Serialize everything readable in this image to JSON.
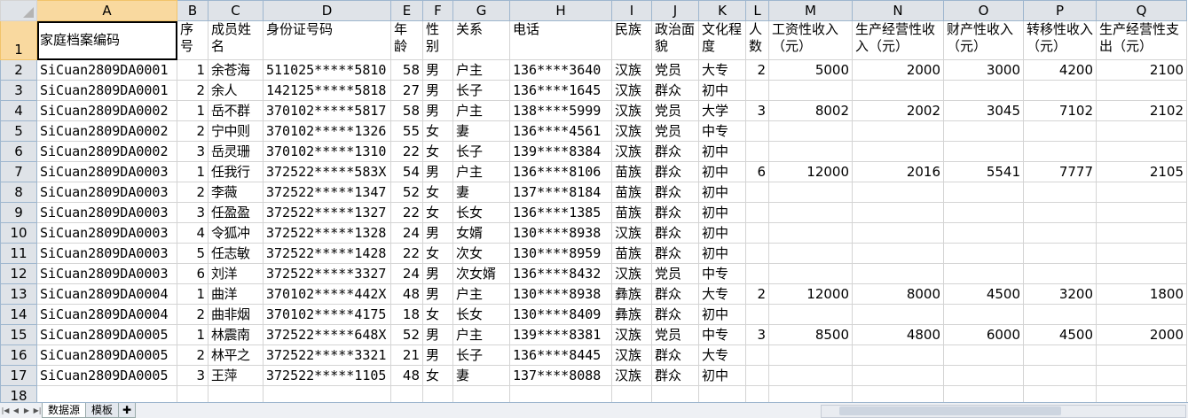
{
  "columns": [
    "A",
    "B",
    "C",
    "D",
    "E",
    "F",
    "G",
    "H",
    "I",
    "J",
    "K",
    "L",
    "M",
    "N",
    "O",
    "P",
    "Q"
  ],
  "header_row": {
    "num": "1",
    "cells": [
      "家庭档案编码",
      "序号",
      "成员姓名",
      "身份证号码",
      "年龄",
      "性别",
      "关系",
      "电话",
      "民族",
      "政治面貌",
      "文化程度",
      "人数",
      "工资性收入（元）",
      "生产经营性收入（元）",
      "财产性收入（元）",
      "转移性收入（元）",
      "生产经营性支出（元）"
    ]
  },
  "rows": [
    {
      "num": "2",
      "cells": [
        "SiCuan2809DA0001",
        "1",
        "余苍海",
        "511025*****5810",
        "58",
        "男",
        "户主",
        "136****3640",
        "汉族",
        "党员",
        "大专",
        "2",
        "5000",
        "2000",
        "3000",
        "4200",
        "2100"
      ]
    },
    {
      "num": "3",
      "cells": [
        "SiCuan2809DA0001",
        "2",
        "余人",
        "142125*****5818",
        "27",
        "男",
        "长子",
        "136****1645",
        "汉族",
        "群众",
        "初中",
        "",
        "",
        "",
        "",
        "",
        ""
      ]
    },
    {
      "num": "4",
      "cells": [
        "SiCuan2809DA0002",
        "1",
        "岳不群",
        "370102*****5817",
        "58",
        "男",
        "户主",
        "138****5999",
        "汉族",
        "党员",
        "大学",
        "3",
        "8002",
        "2002",
        "3045",
        "7102",
        "2102"
      ]
    },
    {
      "num": "5",
      "cells": [
        "SiCuan2809DA0002",
        "2",
        "宁中则",
        "370102*****1326",
        "55",
        "女",
        "妻",
        "136****4561",
        "汉族",
        "党员",
        "中专",
        "",
        "",
        "",
        "",
        "",
        ""
      ]
    },
    {
      "num": "6",
      "cells": [
        "SiCuan2809DA0002",
        "3",
        "岳灵珊",
        "370102*****1310",
        "22",
        "女",
        "长子",
        "139****8384",
        "汉族",
        "群众",
        "初中",
        "",
        "",
        "",
        "",
        "",
        ""
      ]
    },
    {
      "num": "7",
      "cells": [
        "SiCuan2809DA0003",
        "1",
        "任我行",
        "372522*****583X",
        "54",
        "男",
        "户主",
        "136****8106",
        "苗族",
        "群众",
        "初中",
        "6",
        "12000",
        "2016",
        "5541",
        "7777",
        "2105"
      ]
    },
    {
      "num": "8",
      "cells": [
        "SiCuan2809DA0003",
        "2",
        "李薇",
        "372522*****1347",
        "52",
        "女",
        "妻",
        "137****8184",
        "苗族",
        "群众",
        "初中",
        "",
        "",
        "",
        "",
        "",
        ""
      ]
    },
    {
      "num": "9",
      "cells": [
        "SiCuan2809DA0003",
        "3",
        "任盈盈",
        "372522*****1327",
        "22",
        "女",
        "长女",
        "136****1385",
        "苗族",
        "群众",
        "初中",
        "",
        "",
        "",
        "",
        "",
        ""
      ]
    },
    {
      "num": "10",
      "cells": [
        "SiCuan2809DA0003",
        "4",
        "令狐冲",
        "372522*****1328",
        "24",
        "男",
        "女婿",
        "130****8938",
        "汉族",
        "群众",
        "初中",
        "",
        "",
        "",
        "",
        "",
        ""
      ]
    },
    {
      "num": "11",
      "cells": [
        "SiCuan2809DA0003",
        "5",
        "任志敏",
        "372522*****1428",
        "22",
        "女",
        "次女",
        "130****8959",
        "苗族",
        "群众",
        "初中",
        "",
        "",
        "",
        "",
        "",
        ""
      ]
    },
    {
      "num": "12",
      "cells": [
        "SiCuan2809DA0003",
        "6",
        "刘洋",
        "372522*****3327",
        "24",
        "男",
        "次女婿",
        "136****8432",
        "汉族",
        "党员",
        "中专",
        "",
        "",
        "",
        "",
        "",
        ""
      ]
    },
    {
      "num": "13",
      "cells": [
        "SiCuan2809DA0004",
        "1",
        "曲洋",
        "370102*****442X",
        "48",
        "男",
        "户主",
        "130****8938",
        "彝族",
        "群众",
        "大专",
        "2",
        "12000",
        "8000",
        "4500",
        "3200",
        "1800"
      ]
    },
    {
      "num": "14",
      "cells": [
        "SiCuan2809DA0004",
        "2",
        "曲非烟",
        "370102*****4175",
        "18",
        "女",
        "长女",
        "130****8409",
        "彝族",
        "群众",
        "初中",
        "",
        "",
        "",
        "",
        "",
        ""
      ]
    },
    {
      "num": "15",
      "cells": [
        "SiCuan2809DA0005",
        "1",
        "林震南",
        "372522*****648X",
        "52",
        "男",
        "户主",
        "139****8381",
        "汉族",
        "党员",
        "中专",
        "3",
        "8500",
        "4800",
        "6000",
        "4500",
        "2000"
      ]
    },
    {
      "num": "16",
      "cells": [
        "SiCuan2809DA0005",
        "2",
        "林平之",
        "372522*****3321",
        "21",
        "男",
        "长子",
        "136****8445",
        "汉族",
        "群众",
        "大专",
        "",
        "",
        "",
        "",
        "",
        ""
      ]
    },
    {
      "num": "17",
      "cells": [
        "SiCuan2809DA0005",
        "3",
        "王萍",
        "372522*****1105",
        "48",
        "女",
        "妻",
        "137****8088",
        "汉族",
        "群众",
        "初中",
        "",
        "",
        "",
        "",
        "",
        ""
      ]
    },
    {
      "num": "18",
      "cells": [
        "",
        "",
        "",
        "",
        "",
        "",
        "",
        "",
        "",
        "",
        "",
        "",
        "",
        "",
        "",
        "",
        ""
      ]
    }
  ],
  "sheet_tabs": [
    "数据源",
    "模板"
  ],
  "active_tab": "数据源"
}
